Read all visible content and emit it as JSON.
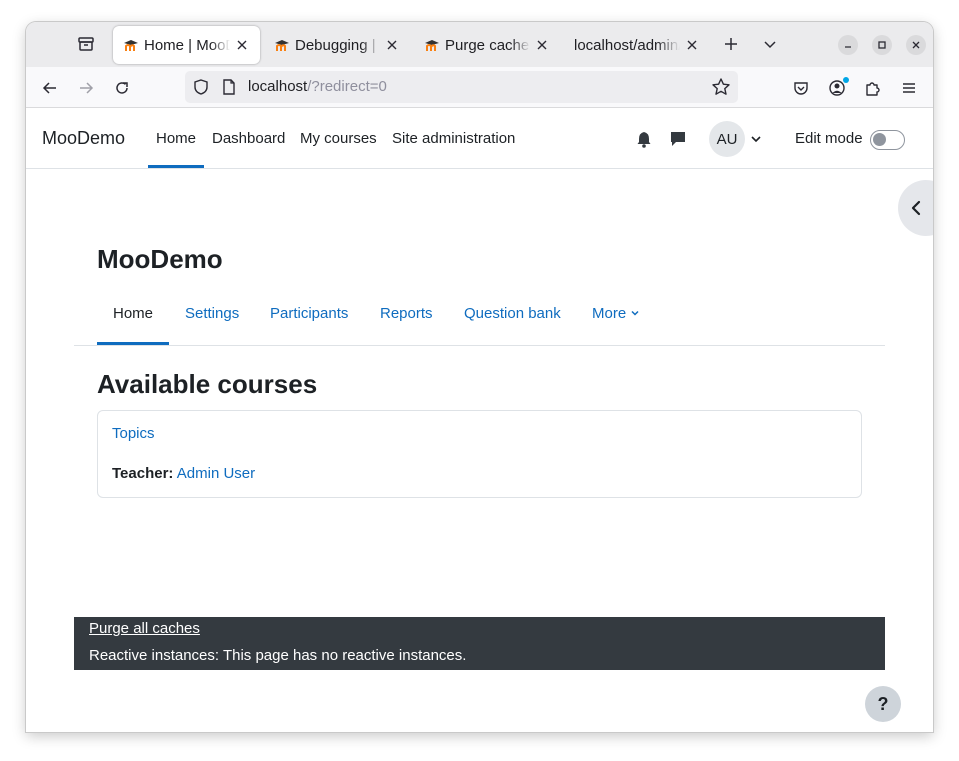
{
  "browser": {
    "tabs": [
      {
        "label": "Home | MooDemo",
        "active": true
      },
      {
        "label": "Debugging | MooDemo",
        "active": false
      },
      {
        "label": "Purge caches",
        "active": false
      },
      {
        "label": "localhost/admin/",
        "active": false
      }
    ],
    "url": {
      "host": "localhost",
      "path": "/?redirect=0"
    }
  },
  "site": {
    "brand": "MooDemo",
    "primary_nav": [
      "Home",
      "Dashboard",
      "My courses",
      "Site administration"
    ],
    "user_initials": "AU",
    "edit_mode_label": "Edit mode"
  },
  "course": {
    "title": "MooDemo",
    "secondary_nav": [
      "Home",
      "Settings",
      "Participants",
      "Reports",
      "Question bank",
      "More"
    ],
    "available_heading": "Available courses",
    "courses": [
      {
        "name": "Topics",
        "teacher_label": "Teacher:",
        "teacher_name": "Admin User"
      }
    ]
  },
  "footer": {
    "purge_link": "Purge all caches",
    "reactive_text": "Reactive instances: This page has no reactive instances."
  },
  "help_label": "?",
  "colors": {
    "link": "#0f6cbf",
    "footer_bg": "#343a40",
    "favicon": "#f98012"
  }
}
